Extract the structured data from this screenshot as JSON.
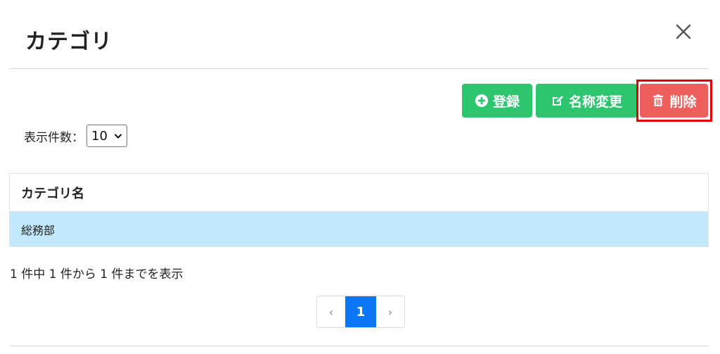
{
  "modal": {
    "title": "カテゴリ",
    "close_icon": "close-icon"
  },
  "toolbar": {
    "register_label": "登録",
    "register_icon": "plus-circle-icon",
    "rename_label": "名称変更",
    "rename_icon": "edit-icon",
    "delete_label": "削除",
    "delete_icon": "trash-icon",
    "primary_color": "#2ec56f",
    "danger_color": "#ee5f5b",
    "highlight_color": "#e00000"
  },
  "page_size": {
    "label": "表示件数：",
    "selected": "10"
  },
  "table": {
    "header": "カテゴリ名",
    "rows": [
      "総務部"
    ],
    "selected_row_color": "#c1e8fb"
  },
  "info": {
    "text": "1 件中 1 件から 1 件までを表示"
  },
  "pagination": {
    "prev": "‹",
    "current": "1",
    "next": "›",
    "active_color": "#0a78f6"
  }
}
